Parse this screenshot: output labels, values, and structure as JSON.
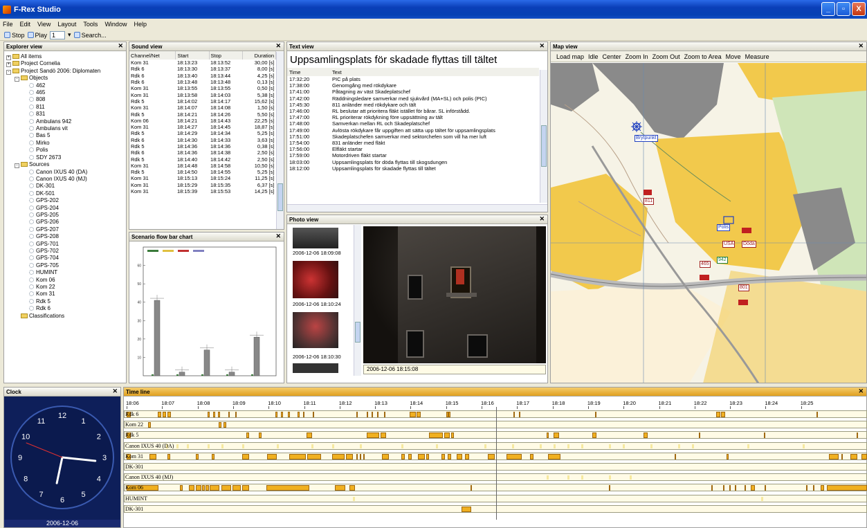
{
  "app": {
    "title": "F-Rex Studio"
  },
  "window_controls": {
    "min": "_",
    "max": "▫",
    "close": "X"
  },
  "menu": [
    "File",
    "Edit",
    "View",
    "Layout",
    "Tools",
    "Window",
    "Help"
  ],
  "toolbar": {
    "stop": "Stop",
    "play": "Play",
    "speed": "1",
    "search": "Search..."
  },
  "explorer": {
    "title": "Explorer view",
    "root": [
      {
        "label": "All items",
        "expander": "+"
      },
      {
        "label": "Project Cornelia",
        "expander": "+"
      },
      {
        "label": "Project Sandö 2006: Diplomaten",
        "expander": "-"
      }
    ],
    "objects_label": "Objects",
    "objects": [
      "462",
      "465",
      "808",
      "811",
      "831",
      "Ambulans 942",
      "Ambulans vit",
      "Bas 5",
      "Mirko",
      "Polis",
      "SDY 2673"
    ],
    "sources_label": "Sources",
    "sources": [
      "Canon IXUS 40 (DA)",
      "Canon IXUS 40 (MJ)",
      "DK-301",
      "DK-501",
      "GPS-202",
      "GPS-204",
      "GPS-205",
      "GPS-206",
      "GPS-207",
      "GPS-208",
      "GPS-701",
      "GPS-702",
      "GPS-704",
      "GPS-705",
      "HUMINT",
      "Kom 06",
      "Kom 22",
      "Kom 31",
      "Rdk 5",
      "Rdk 6"
    ],
    "classifications": "Classifications"
  },
  "sound": {
    "title": "Sound view",
    "headers": [
      "Channel/Net",
      "Start",
      "Stop",
      "Duration"
    ],
    "rows": [
      [
        "Kom 31",
        "18:13:23",
        "18:13:52",
        "30,00 [s]"
      ],
      [
        "Rdk 6",
        "18:13:30",
        "18:13:37",
        "8,00 [s]"
      ],
      [
        "Rdk 6",
        "18:13:40",
        "18:13:44",
        "4,25 [s]"
      ],
      [
        "Rdk 6",
        "18:13:48",
        "18:13:48",
        "0,13 [s]"
      ],
      [
        "Kom 31",
        "18:13:55",
        "18:13:55",
        "0,50 [s]"
      ],
      [
        "Kom 31",
        "18:13:58",
        "18:14:03",
        "5,38 [s]"
      ],
      [
        "Rdk 5",
        "18:14:02",
        "18:14:17",
        "15,62 [s]"
      ],
      [
        "Kom 31",
        "18:14:07",
        "18:14:08",
        "1,50 [s]"
      ],
      [
        "Rdk 5",
        "18:14:21",
        "18:14:26",
        "5,50 [s]"
      ],
      [
        "Kom 06",
        "18:14:21",
        "18:14:43",
        "22,25 [s]"
      ],
      [
        "Kom 31",
        "18:14:27",
        "18:14:45",
        "18,87 [s]"
      ],
      [
        "Rdk 5",
        "18:14:29",
        "18:14:34",
        "5,25 [s]"
      ],
      [
        "Rdk 6",
        "18:14:30",
        "18:14:33",
        "3,63 [s]"
      ],
      [
        "Rdk 5",
        "18:14:36",
        "18:14:36",
        "0,38 [s]"
      ],
      [
        "Rdk 6",
        "18:14:36",
        "18:14:38",
        "2,50 [s]"
      ],
      [
        "Rdk 5",
        "18:14:40",
        "18:14:42",
        "2,50 [s]"
      ],
      [
        "Kom 31",
        "18:14:48",
        "18:14:58",
        "10,50 [s]"
      ],
      [
        "Rdk 5",
        "18:14:50",
        "18:14:55",
        "5,25 [s]"
      ],
      [
        "Kom 31",
        "18:15:13",
        "18:15:24",
        "11,25 [s]"
      ],
      [
        "Kom 31",
        "18:15:29",
        "18:15:35",
        "6,37 [s]"
      ],
      [
        "Kom 31",
        "18:15:39",
        "18:15:53",
        "14,25 [s]"
      ]
    ]
  },
  "chart": {
    "title": "Scenario flow bar chart"
  },
  "chart_data": {
    "type": "bar",
    "series": [
      {
        "values": [
          41,
          2,
          14,
          2,
          21
        ]
      }
    ],
    "ylim": [
      0,
      70
    ],
    "y_ticks": [
      "60",
      "50",
      "40",
      "30",
      "20",
      "10"
    ]
  },
  "text": {
    "title": "Text view",
    "headline": "Uppsamlingsplats för skadade flyttas till tältet",
    "headers": [
      "Time",
      "Text"
    ],
    "rows": [
      [
        "17:32:20",
        "PIC på plats"
      ],
      [
        "17:38:00",
        "Genomgång med rökdykare"
      ],
      [
        "17:41:00",
        "Påtagning av väst Skadeplatschef"
      ],
      [
        "17:42:00",
        "Räddningsledare samverkar med sjukvård (MA+SL) och polis (PIC)"
      ],
      [
        "17:45:30",
        "811 anländer med rökdykare och tält"
      ],
      [
        "17:46:00",
        "RL beslutar att prioritera fläkt istället för bårar. SL införstådd."
      ],
      [
        "17:47:00",
        "RL prioriterar rökdykning före uppsättning av tält"
      ],
      [
        "17:48:00",
        "Samverkan mellan RL och Skadeplatschef"
      ],
      [
        "17:49:00",
        "Avlösta rökdykare får uppgiften att sätta upp tältet för uppsamlingsplats"
      ],
      [
        "17:51:00",
        "Skadeplatschefen samverkar med sektorchefen som vill ha mer luft"
      ],
      [
        "17:54:00",
        "831 anländer med fläkt"
      ],
      [
        "17:56:00",
        "Elfläkt startar"
      ],
      [
        "17:59:00",
        "Motordriven fläkt startar"
      ],
      [
        "18:03:00",
        "Uppsamlingsplats för döda flyttas till skogsdungen"
      ],
      [
        "18:12:00",
        "Uppsamlingsplats för skadade flyttas till tältet"
      ]
    ]
  },
  "photo": {
    "title": "Photo view",
    "thumbs": [
      "2006-12-06 18:09:08",
      "2006-12-06 18:10:24",
      "2006-12-06 18:10:30"
    ],
    "caption": "2006-12-06 18:15:08"
  },
  "map": {
    "title": "Map view",
    "toolbar": [
      "Load map",
      "Idle",
      "Center",
      "Zoom In",
      "Zoom Out",
      "Zoom to Area",
      "Move",
      "Measure"
    ],
    "markers": {
      "brytpunkt": "Brytpunkt",
      "m811": "811",
      "polis": "Polis",
      "usa": "USA",
      "doda": "Döda",
      "m942": "942",
      "m465": "465",
      "m801": "801"
    }
  },
  "clock": {
    "title": "Clock",
    "numbers": [
      "12",
      "1",
      "2",
      "3",
      "4",
      "5",
      "6",
      "7",
      "8",
      "9",
      "10",
      "11"
    ],
    "date": "2006-12-06"
  },
  "timeline": {
    "title": "Time line",
    "ticks": [
      "18:06",
      "18:07",
      "18:08",
      "18:09",
      "18:10",
      "18:11",
      "18:12",
      "18:13",
      "18:14",
      "18:15",
      "18:16",
      "18:17",
      "18:18",
      "18:19",
      "18:20",
      "18:21",
      "18:22",
      "18:23",
      "18:24",
      "18:25"
    ],
    "rows": [
      "Rdk 6",
      "Kom 22",
      "Rdk 5",
      "Canon IXUS 40 (DA)",
      "Kom 31",
      "DK-301",
      "Canon IXUS 40 (MJ)",
      "Kom 06",
      "HUMINT",
      "DK-301"
    ]
  }
}
